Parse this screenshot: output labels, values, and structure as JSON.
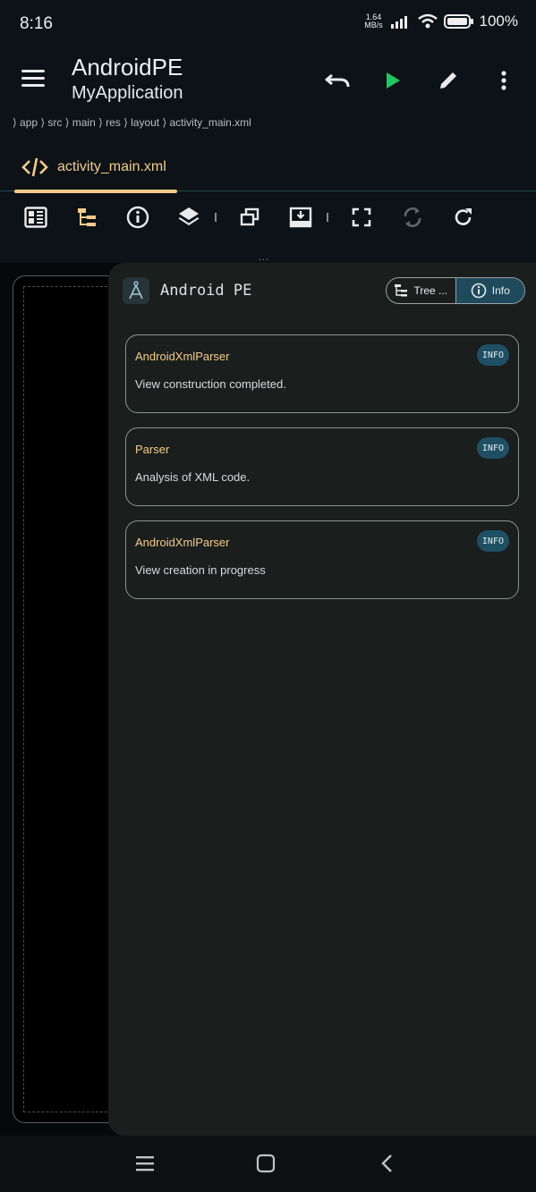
{
  "status": {
    "time": "8:16",
    "net_speed_value": "1.64",
    "net_speed_unit": "MB/s",
    "battery": "100%"
  },
  "appbar": {
    "title": "AndroidPE",
    "subtitle": "MyApplication"
  },
  "breadcrumb": "⟩ app ⟩ src ⟩ main ⟩ res ⟩ layout ⟩ activity_main.xml",
  "file_tab": {
    "label": "activity_main.xml"
  },
  "toolbar_handle": "...",
  "panel": {
    "title": "Android PE",
    "segments": {
      "tree": "Tree ...",
      "info": "Info"
    },
    "logs": [
      {
        "source": "AndroidXmlParser",
        "message": "View construction completed.",
        "level": "INFO"
      },
      {
        "source": "Parser",
        "message": "Analysis of XML code.",
        "level": "INFO"
      },
      {
        "source": "AndroidXmlParser",
        "message": "View creation in progress",
        "level": "INFO"
      }
    ]
  },
  "colors": {
    "accent": "#f3cc8d",
    "run": "#22c55e",
    "badge": "#1f4f63",
    "panel": "#1a1e1d",
    "background": "#0c1216"
  }
}
